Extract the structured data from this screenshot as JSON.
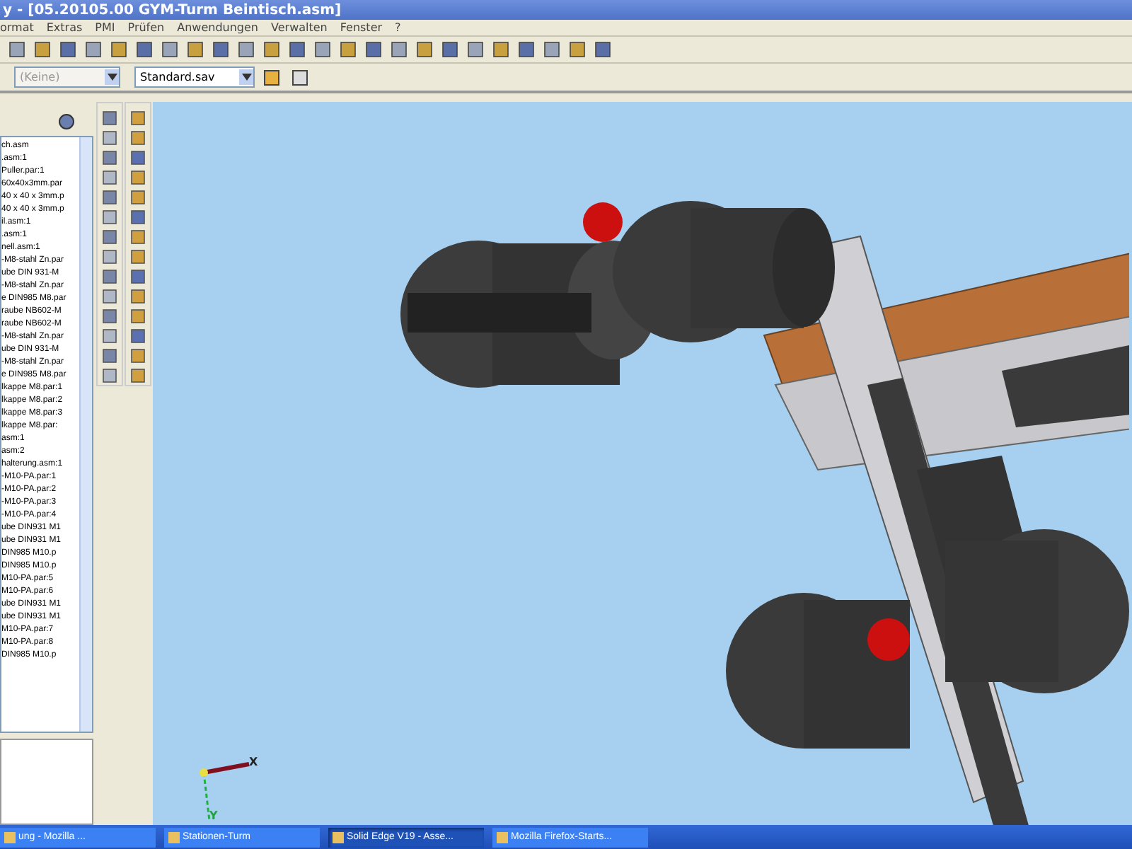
{
  "window": {
    "title": "y - [05.20105.00 GYM-Turm Beintisch.asm]"
  },
  "menu": [
    "ormat",
    "Extras",
    "PMI",
    "Prüfen",
    "Anwendungen",
    "Verwalten",
    "Fenster",
    "?"
  ],
  "toolbar": {
    "layer_combo": {
      "value": "(Keine)",
      "disabled": true
    },
    "style_combo": {
      "value": "Standard.sav",
      "disabled": false
    }
  },
  "tree": {
    "items": [
      "ch.asm",
      ".asm:1",
      "Puller.par:1",
      "60x40x3mm.par",
      "40 x 40 x 3mm.p",
      "40 x 40 x 3mm.p",
      "il.asm:1",
      ".asm:1",
      "nell.asm:1",
      "-M8-stahl Zn.par",
      "ube DIN 931-M",
      "-M8-stahl Zn.par",
      "e DIN985 M8.par",
      "raube NB602-M",
      "raube NB602-M",
      "-M8-stahl Zn.par",
      "ube DIN 931-M",
      "-M8-stahl Zn.par",
      "e DIN985 M8.par",
      "lkappe M8.par:1",
      "lkappe M8.par:2",
      "lkappe M8.par:3",
      "lkappe M8.par:",
      "asm:1",
      "asm:2",
      "halterung.asm:1",
      "-M10-PA.par:1",
      "-M10-PA.par:2",
      "-M10-PA.par:3",
      "-M10-PA.par:4",
      "ube DIN931 M1",
      "ube DIN931 M1",
      "DIN985 M10.p",
      "DIN985 M10.p",
      "M10-PA.par:5",
      "M10-PA.par:6",
      "ube DIN931 M1",
      "ube DIN931 M1",
      "M10-PA.par:7",
      "M10-PA.par:8",
      "DIN985 M10.p"
    ]
  },
  "viewport": {
    "axis_x": "X",
    "axis_y": "Y"
  },
  "taskbar": [
    {
      "label": "ung - Mozilla ...",
      "selected": false
    },
    {
      "label": "Stationen-Turm",
      "selected": false
    },
    {
      "label": "Solid Edge V19 - Asse...",
      "selected": true
    },
    {
      "label": "Mozilla Firefox-Starts...",
      "selected": false
    }
  ]
}
